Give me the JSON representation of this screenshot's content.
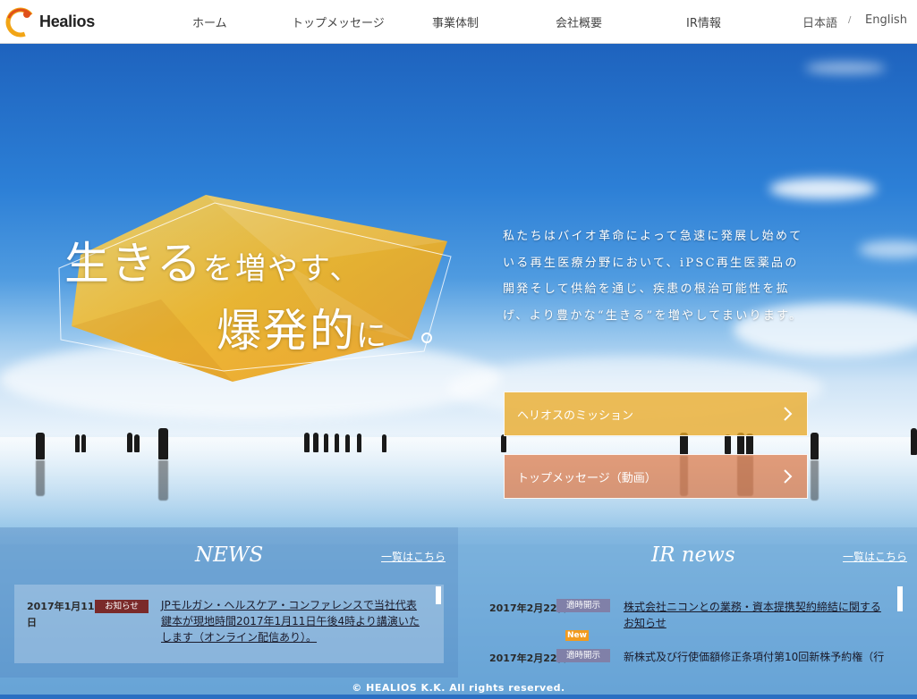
{
  "header": {
    "logo_text": "Healios",
    "nav": [
      "ホーム",
      "トップメッセージ",
      "事業体制",
      "会社概要",
      "IR情報"
    ],
    "lang_ja": "日本語",
    "lang_sep": "/",
    "lang_en": "English"
  },
  "hero": {
    "headline_line1_big": "生きる",
    "headline_line1_small": "を増やす、",
    "headline_line2_big": "爆発的",
    "headline_line2_small": "に",
    "intro": "私たちはバイオ革命によって急速に発展し始めている再生医療分野において、iPSC再生医薬品の開発そして供給を通じ、疾患の根治可能性を拡げ、より豊かな“生きる”を増やしてまいります。",
    "cta_mission": "ヘリオスのミッション",
    "cta_message": "トップメッセージ（動画）"
  },
  "news": {
    "title": "NEWS",
    "more": "一覧はこちら",
    "items": [
      {
        "date_line1": "2017年1月11",
        "date_line2": "日",
        "badge": "お知らせ",
        "title": "JPモルガン・ヘルスケア・コンファレンスで当社代表鍵本が現地時間2017年1月11日午後4時より講演いたします（オンライン配信あり）。"
      }
    ]
  },
  "ir_news": {
    "title": "IR news",
    "more": "一覧はこちら",
    "items": [
      {
        "date": "2017年2月22日",
        "badge": "適時開示",
        "new_badge": "New",
        "title": "株式会社ニコンとの業務・資本提携契約締結に関するお知らせ"
      },
      {
        "date": "2017年2月22日",
        "badge": "適時開示",
        "title": "新株式及び行使価額修正条項付第10回新株予約権（行"
      }
    ]
  },
  "footer": {
    "copyright": "© HEALIOS K.K. All rights reserved."
  },
  "colors": {
    "mission_button": "#EBAA28",
    "message_button": "#DC7846",
    "badge_info": "#7A2A2A",
    "badge_ir": "#8080A8",
    "badge_new": "#F29B1E"
  }
}
